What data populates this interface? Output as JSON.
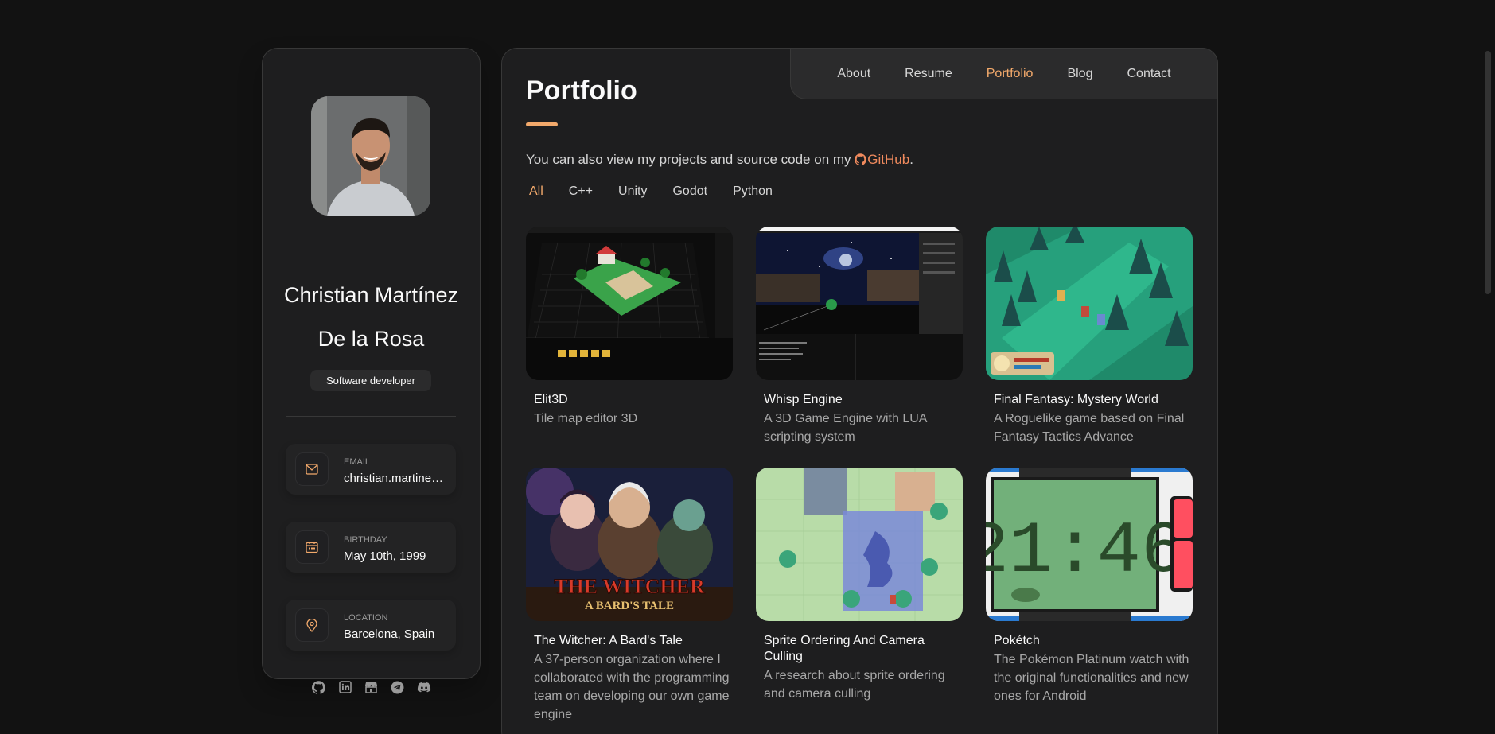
{
  "profile": {
    "name_line1": "Christian Martínez",
    "name_line2": "De la Rosa",
    "role": "Software developer"
  },
  "contacts": [
    {
      "label": "EMAIL",
      "value": "christian.martinez.delarosa@gmail.com",
      "icon": "mail-icon"
    },
    {
      "label": "BIRTHDAY",
      "value": "May 10th, 1999",
      "icon": "calendar-icon"
    },
    {
      "label": "LOCATION",
      "value": "Barcelona, Spain",
      "icon": "location-icon"
    }
  ],
  "socials": [
    "github-icon",
    "linkedin-icon",
    "itchio-icon",
    "telegram-icon",
    "discord-icon"
  ],
  "nav": {
    "items": [
      "About",
      "Resume",
      "Portfolio",
      "Blog",
      "Contact"
    ],
    "active": "Portfolio"
  },
  "page": {
    "title": "Portfolio",
    "intro_prefix": "You can also view my projects and source code on my ",
    "intro_link": "GitHub",
    "intro_suffix": "."
  },
  "filters": {
    "items": [
      "All",
      "C++",
      "Unity",
      "Godot",
      "Python"
    ],
    "active": "All"
  },
  "projects": [
    {
      "title": "Elit3D",
      "desc": "Tile map editor 3D"
    },
    {
      "title": "Whisp Engine",
      "desc": "A 3D Game Engine with LUA scripting system"
    },
    {
      "title": "Final Fantasy: Mystery World",
      "desc": "A Roguelike game based on Final Fantasy Tactics Advance"
    },
    {
      "title": "The Witcher: A Bard's Tale",
      "desc": "A 37-person organization where I collaborated with the programming team on developing our own game engine"
    },
    {
      "title": "Sprite Ordering And Camera Culling",
      "desc": "A research about sprite ordering and camera culling"
    },
    {
      "title": "Pokétch",
      "desc": "The Pokémon Platinum watch with the original functionalities and new ones for Android"
    }
  ],
  "pokétch_time": "21:46",
  "witcher_logo": {
    "line1": "THE WITCHER",
    "line2": "A BARD'S TALE"
  },
  "colors": {
    "accent": "#f2a96b",
    "link": "#f08a5d",
    "background": "#121212",
    "card": "#1e1e1f"
  }
}
